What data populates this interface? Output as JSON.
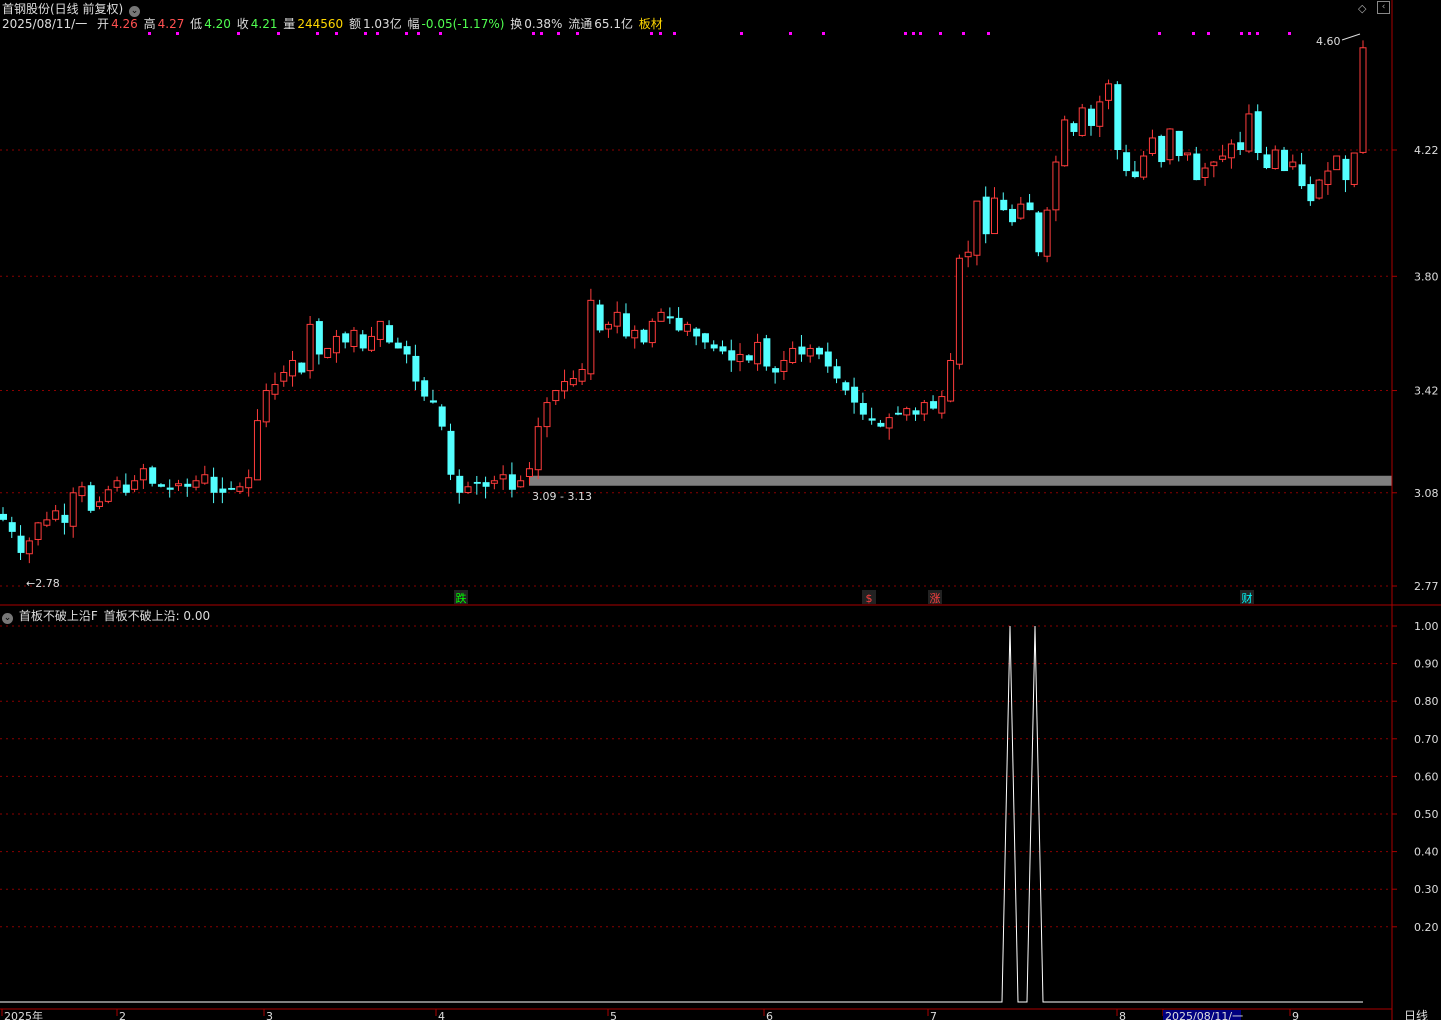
{
  "header": {
    "stock_title": "首钢股份(日线 前复权)",
    "date_label": "2025/08/11/一",
    "open_label": "开",
    "open_value": "4.26",
    "high_label": "高",
    "high_value": "4.27",
    "low_label": "低",
    "low_value": "4.20",
    "close_label": "收",
    "close_value": "4.21",
    "volume_label": "量",
    "volume_value": "244560",
    "amount_label": "额",
    "amount_value": "1.03亿",
    "change_label": "幅",
    "change_value": "-0.05(-1.17%)",
    "turnover_label": "换",
    "turnover_value": "0.38%",
    "float_label": "流通",
    "float_value": "65.1亿",
    "sector": "板材"
  },
  "indicator": {
    "name": "首板不破上沿F",
    "value_label": "首板不破上沿: 0.00"
  },
  "colors": {
    "up": "#ff3c3c",
    "down": "#54ffff",
    "grid": "#8b0000",
    "axis": "#aa0000",
    "marker": "#ff00ff",
    "band": "#808080",
    "indicator_line": "#ffffff"
  },
  "chart_data": [
    {
      "type": "candlestick",
      "title": "首钢股份(日线 前复权)",
      "y_ticks": [
        "4.22",
        "3.80",
        "3.42",
        "3.08",
        "2.77"
      ],
      "ylim": [
        2.74,
        4.84
      ],
      "x_ticks": [
        "2025年",
        "2",
        "3",
        "4",
        "5",
        "6",
        "7",
        "8",
        "2025/08/11/一",
        "9"
      ],
      "period_label": "日线",
      "annotations": {
        "low_mark": "2.78",
        "high_mark": "4.60",
        "band_label": "3.09 - 3.13",
        "band_range": [
          3.09,
          3.13
        ],
        "events": [
          "跌",
          "$",
          "涨",
          "财"
        ]
      },
      "close_path": [
        2.99,
        2.95,
        2.88,
        2.92,
        2.98,
        2.99,
        3.02,
        2.98,
        3.08,
        3.1,
        3.02,
        3.05,
        3.09,
        3.12,
        3.08,
        3.12,
        3.16,
        3.11,
        3.1,
        3.09,
        3.11,
        3.1,
        3.12,
        3.14,
        3.08,
        3.08,
        3.09,
        3.1,
        3.13,
        3.32,
        3.42,
        3.44,
        3.48,
        3.52,
        3.48,
        3.64,
        3.54,
        3.56,
        3.6,
        3.58,
        3.62,
        3.56,
        3.6,
        3.65,
        3.58,
        3.56,
        3.54,
        3.45,
        3.4,
        3.38,
        3.3,
        3.14,
        3.08,
        3.1,
        3.11,
        3.1,
        3.12,
        3.14,
        3.09,
        3.12,
        3.16,
        3.3,
        3.38,
        3.42,
        3.45,
        3.46,
        3.49,
        3.72,
        3.62,
        3.64,
        3.68,
        3.6,
        3.62,
        3.58,
        3.65,
        3.68,
        3.66,
        3.62,
        3.64,
        3.6,
        3.58,
        3.56,
        3.55,
        3.52,
        3.54,
        3.52,
        3.58,
        3.5,
        3.48,
        3.52,
        3.56,
        3.54,
        3.56,
        3.54,
        3.5,
        3.46,
        3.42,
        3.38,
        3.34,
        3.32,
        3.3,
        3.33,
        3.34,
        3.36,
        3.34,
        3.38,
        3.36,
        3.4,
        3.52,
        3.86,
        3.88,
        4.05,
        3.94,
        4.06,
        4.02,
        3.98,
        4.04,
        4.02,
        3.88,
        4.02,
        4.18,
        4.32,
        4.28,
        4.36,
        4.3,
        4.38,
        4.44,
        4.22,
        4.15,
        4.13,
        4.2,
        4.26,
        4.18,
        4.29,
        4.2,
        4.21,
        4.12,
        4.16,
        4.18,
        4.2,
        4.24,
        4.22,
        4.34,
        4.21,
        4.16,
        4.22,
        4.15,
        4.18,
        4.1,
        4.05,
        4.12,
        4.15,
        4.2,
        4.12,
        4.21,
        4.56
      ]
    },
    {
      "type": "line",
      "title": "首板不破上沿F",
      "y_ticks": [
        "1.00",
        "0.90",
        "0.80",
        "0.70",
        "0.60",
        "0.50",
        "0.40",
        "0.30",
        "0.20"
      ],
      "ylim": [
        0,
        1.0
      ],
      "series": [
        {
          "name": "首板不破上沿",
          "spikes_at_bar": [
            125,
            129
          ],
          "spike_value": 1.0,
          "baseline": 0.0
        }
      ]
    }
  ]
}
